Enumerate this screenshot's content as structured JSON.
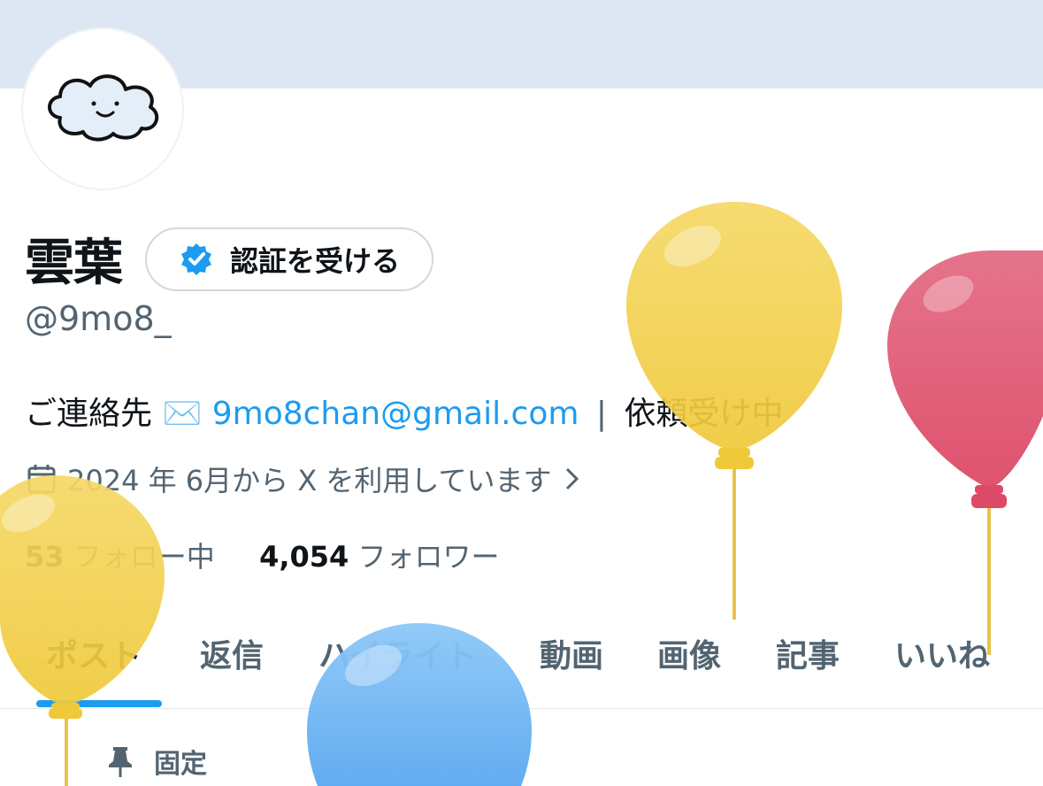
{
  "profile": {
    "display_name": "雲葉",
    "verify_button_label": "認証を受ける",
    "handle": "@9mo8_",
    "bio_prefix": "ご連絡先 ",
    "bio_mail_emoji": "✉️",
    "bio_email": "9mo8chan@gmail.com",
    "bio_separator": "|",
    "bio_suffix": "依頼受け中",
    "joined": "2024 年 6月から X を利用しています",
    "following_count": "53",
    "following_label": "フォロー中",
    "followers_count": "4,054",
    "followers_label": "フォロワー"
  },
  "tabs": [
    {
      "label": "ポスト",
      "active": true
    },
    {
      "label": "返信"
    },
    {
      "label": "ハイライト"
    },
    {
      "label": "動画"
    },
    {
      "label": "画像"
    },
    {
      "label": "記事"
    },
    {
      "label": "いいね"
    }
  ],
  "pinned_label": "固定",
  "colors": {
    "accent": "#1d9bf0",
    "banner": "#dde7f3",
    "secondary_text": "#536471",
    "balloon_yellow": "#f3d35c",
    "balloon_red": "#e2546f",
    "balloon_blue": "#6cb4f4"
  },
  "icons": [
    "verified-badge-icon",
    "mail-icon",
    "calendar-icon",
    "chevron-right-icon",
    "pin-icon",
    "cloud-avatar-icon"
  ]
}
